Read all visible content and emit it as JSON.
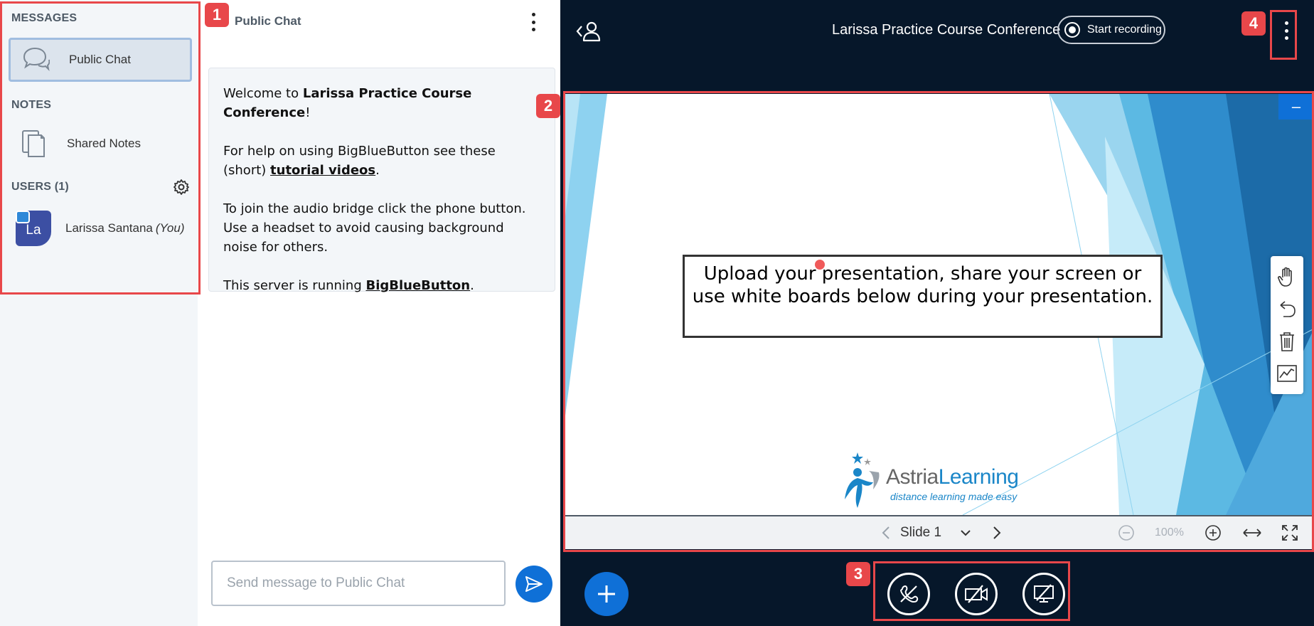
{
  "sidebar": {
    "messages_title": "MESSAGES",
    "public_chat_label": "Public Chat",
    "notes_title": "NOTES",
    "shared_notes_label": "Shared Notes",
    "users_title": "USERS (1)",
    "user": {
      "avatar_initials": "La",
      "name": "Larissa Santana",
      "you_label": "(You)"
    }
  },
  "chat": {
    "title": "Public Chat",
    "welcome": {
      "line1_prefix": "Welcome to ",
      "line1_name": "Larissa Practice Course Conference",
      "line1_suffix": "!",
      "help_prefix": "For help on using BigBlueButton see these (short) ",
      "help_link": "tutorial videos",
      "help_suffix": ".",
      "audio_text": "To join the audio bridge click the phone button. Use a headset to avoid causing background noise for others.",
      "server_prefix": "This server is running ",
      "server_link": "BigBlueButton",
      "server_suffix": "."
    },
    "input_placeholder": "Send message to Public Chat"
  },
  "header": {
    "meeting_title": "Larissa Practice Course Conference",
    "record_label": "Start recording"
  },
  "presentation": {
    "slide_text": "Upload your presentation, share your screen or use white boards below during your presentation.",
    "logo_name_part1": "Astria",
    "logo_name_part2": "Learning",
    "logo_tagline": "distance learning made easy",
    "slide_label": "Slide 1",
    "zoom_label": "100%",
    "minimize_label": "–"
  },
  "annotations": {
    "badge1": "1",
    "badge2": "2",
    "badge3": "3",
    "badge4": "4"
  },
  "colors": {
    "accent": "#0f70d7",
    "dark_bg": "#06172a",
    "callout": "#e8474a"
  }
}
